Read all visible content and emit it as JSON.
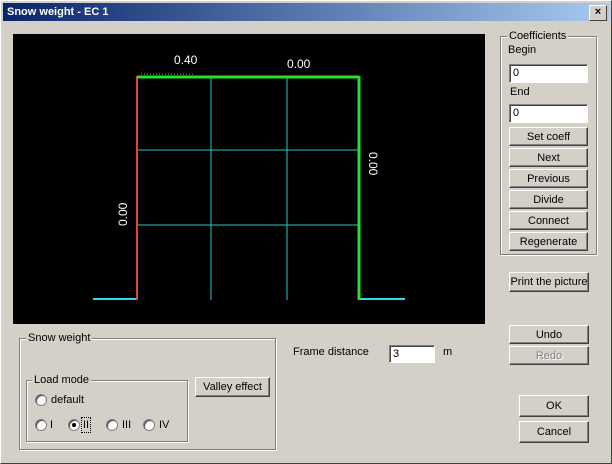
{
  "window": {
    "title": "Snow weight - EC 1",
    "close_glyph": "×"
  },
  "canvas": {
    "labels": {
      "top_left": "0.40",
      "top_right": "0.00",
      "left_side": "0.00",
      "right_side": "0.00"
    },
    "colors": {
      "background": "#000000",
      "grid": "#28c8c8",
      "frame_top": "#28e028",
      "frame_left": "#e04830",
      "frame_right": "#28e028",
      "ground": "#28d8f0",
      "text": "#ffffff"
    }
  },
  "coefficients": {
    "group_label": "Coefficients",
    "begin_label": "Begin",
    "begin_value": "0",
    "end_label": "End",
    "end_value": "0",
    "buttons": {
      "set_coeff": "Set coeff",
      "next": "Next",
      "previous": "Previous",
      "divide": "Divide",
      "connect": "Connect",
      "regenerate": "Regenerate"
    }
  },
  "print_button": "Print the picture",
  "undo_button": "Undo",
  "redo_button": "Redo",
  "ok_button": "OK",
  "cancel_button": "Cancel",
  "snow_weight": {
    "group_label": "Snow weight",
    "load_mode": {
      "group_label": "Load mode",
      "options": [
        {
          "label": "default",
          "selected": false
        },
        {
          "label": "I",
          "selected": false
        },
        {
          "label": "II",
          "selected": true
        },
        {
          "label": "III",
          "selected": false
        },
        {
          "label": "IV",
          "selected": false
        }
      ]
    },
    "valley_effect_button": "Valley effect"
  },
  "frame_distance": {
    "label": "Frame distance",
    "value": "3",
    "unit": "m"
  }
}
